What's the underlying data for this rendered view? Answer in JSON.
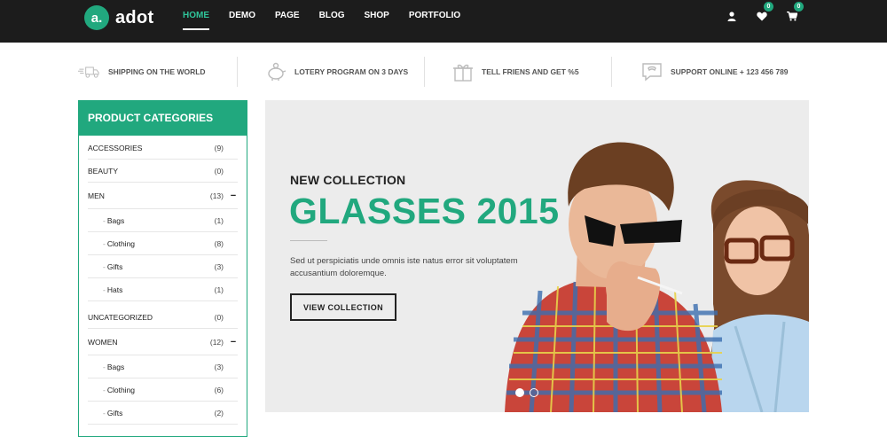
{
  "brand": {
    "mark": "a.",
    "name": "adot",
    "accent": "#21a87e"
  },
  "nav": {
    "items": [
      "HOME",
      "DEMO",
      "PAGE",
      "BLOG",
      "SHOP",
      "PORTFOLIO"
    ],
    "active": "HOME"
  },
  "header_icons": {
    "account": "user-icon",
    "wishlist_count": "0",
    "cart_count": "0"
  },
  "features": [
    {
      "label": "SHIPPING ON THE WORLD",
      "icon": "truck-icon"
    },
    {
      "label": "LOTERY PROGRAM ON 3 DAYS",
      "icon": "piggy-bank-icon"
    },
    {
      "label": "TELL FRIENS AND GET %5",
      "icon": "gift-icon"
    },
    {
      "label": "SUPPORT ONLINE + 123 456 789",
      "icon": "chat-phone-icon"
    }
  ],
  "sidebar": {
    "title": "PRODUCT CATEGORIES",
    "categories": [
      {
        "name": "ACCESSORIES",
        "count": "(9)"
      },
      {
        "name": "BEAUTY",
        "count": "(0)"
      },
      {
        "name": "MEN",
        "count": "(13)",
        "toggle": "−"
      },
      {
        "name": "Bags",
        "count": "(1)"
      },
      {
        "name": "Clothing",
        "count": "(8)"
      },
      {
        "name": "Gifts",
        "count": "(3)"
      },
      {
        "name": "Hats",
        "count": "(1)"
      },
      {
        "name": "UNCATEGORIZED",
        "count": "(0)"
      },
      {
        "name": "WOMEN",
        "count": "(12)",
        "toggle": "−"
      },
      {
        "name": "Bags",
        "count": "(3)"
      },
      {
        "name": "Clothing",
        "count": "(6)"
      },
      {
        "name": "Gifts",
        "count": "(2)"
      }
    ]
  },
  "hero": {
    "kicker": "NEW COLLECTION",
    "title": "GLASSES 2015",
    "description": "Sed ut perspiciatis unde omnis iste natus error sit voluptatem accusantium doloremque.",
    "button": "VIEW COLLECTION",
    "slide_index": 1,
    "slide_total": 2
  }
}
